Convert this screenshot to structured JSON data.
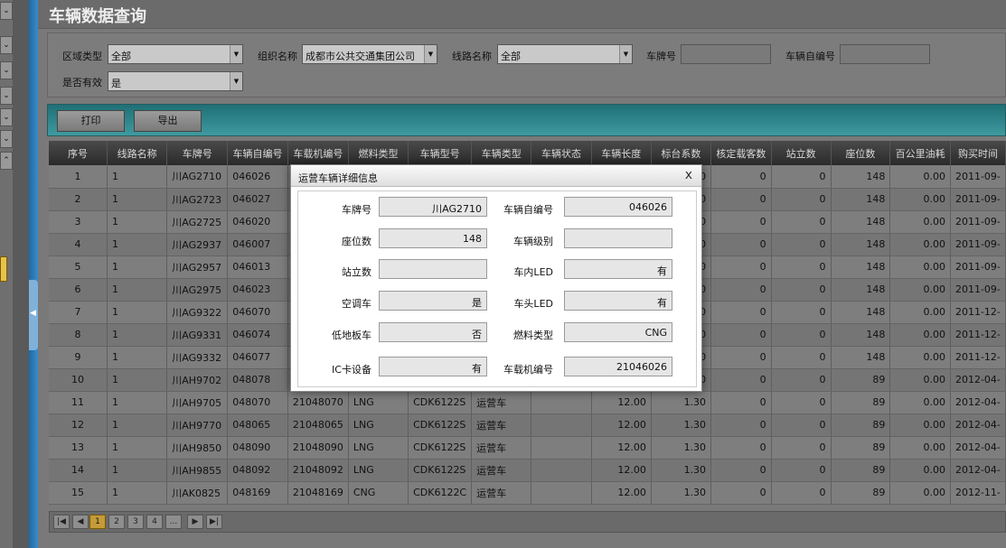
{
  "page_title": "车辆数据查询",
  "filters": {
    "area_type": {
      "label": "区域类型",
      "value": "全部"
    },
    "org_name": {
      "label": "组织名称",
      "value": "成都市公共交通集团公司"
    },
    "line_name": {
      "label": "线路名称",
      "value": "全部"
    },
    "plate_no": {
      "label": "车牌号",
      "value": ""
    },
    "self_no": {
      "label": "车辆自编号",
      "value": ""
    },
    "valid": {
      "label": "是否有效",
      "value": "是"
    }
  },
  "toolbar": {
    "print_label": "打印",
    "export_label": "导出"
  },
  "table": {
    "columns": [
      "序号",
      "线路名称",
      "车牌号",
      "车辆自编号",
      "车载机编号",
      "燃料类型",
      "车辆型号",
      "车辆类型",
      "车辆状态",
      "车辆长度",
      "标台系数",
      "核定载客数",
      "站立数",
      "座位数",
      "百公里油耗",
      "购买时间"
    ],
    "rows": [
      [
        "1",
        "1",
        "川AG2710",
        "046026",
        "",
        "",
        "",
        "",
        "",
        "",
        "0",
        "0",
        "0",
        "148",
        "0.00",
        "2011-09-"
      ],
      [
        "2",
        "1",
        "川AG2723",
        "046027",
        "",
        "",
        "",
        "",
        "",
        "",
        "0",
        "0",
        "0",
        "148",
        "0.00",
        "2011-09-"
      ],
      [
        "3",
        "1",
        "川AG2725",
        "046020",
        "",
        "",
        "",
        "",
        "",
        "",
        "0",
        "0",
        "0",
        "148",
        "0.00",
        "2011-09-"
      ],
      [
        "4",
        "1",
        "川AG2937",
        "046007",
        "",
        "",
        "",
        "",
        "",
        "",
        "0",
        "0",
        "0",
        "148",
        "0.00",
        "2011-09-"
      ],
      [
        "5",
        "1",
        "川AG2957",
        "046013",
        "",
        "",
        "",
        "",
        "",
        "",
        "0",
        "0",
        "0",
        "148",
        "0.00",
        "2011-09-"
      ],
      [
        "6",
        "1",
        "川AG2975",
        "046023",
        "",
        "",
        "",
        "",
        "",
        "",
        "0",
        "0",
        "0",
        "148",
        "0.00",
        "2011-09-"
      ],
      [
        "7",
        "1",
        "川AG9322",
        "046070",
        "",
        "",
        "",
        "",
        "",
        "",
        "0",
        "0",
        "0",
        "148",
        "0.00",
        "2011-12-"
      ],
      [
        "8",
        "1",
        "川AG9331",
        "046074",
        "",
        "",
        "",
        "",
        "",
        "",
        "0",
        "0",
        "0",
        "148",
        "0.00",
        "2011-12-"
      ],
      [
        "9",
        "1",
        "川AG9332",
        "046077",
        "",
        "",
        "",
        "",
        "",
        "",
        "0",
        "0",
        "0",
        "148",
        "0.00",
        "2011-12-"
      ],
      [
        "10",
        "1",
        "川AH9702",
        "048078",
        "",
        "",
        "",
        "",
        "",
        "",
        "0",
        "0",
        "0",
        "89",
        "0.00",
        "2012-04-"
      ],
      [
        "11",
        "1",
        "川AH9705",
        "048070",
        "21048070",
        "LNG",
        "CDK6122S",
        "运营车",
        "",
        "12.00",
        "1.30",
        "0",
        "0",
        "89",
        "0.00",
        "2012-04-"
      ],
      [
        "12",
        "1",
        "川AH9770",
        "048065",
        "21048065",
        "LNG",
        "CDK6122S",
        "运营车",
        "",
        "12.00",
        "1.30",
        "0",
        "0",
        "89",
        "0.00",
        "2012-04-"
      ],
      [
        "13",
        "1",
        "川AH9850",
        "048090",
        "21048090",
        "LNG",
        "CDK6122S",
        "运营车",
        "",
        "12.00",
        "1.30",
        "0",
        "0",
        "89",
        "0.00",
        "2012-04-"
      ],
      [
        "14",
        "1",
        "川AH9855",
        "048092",
        "21048092",
        "LNG",
        "CDK6122S",
        "运营车",
        "",
        "12.00",
        "1.30",
        "0",
        "0",
        "89",
        "0.00",
        "2012-04-"
      ],
      [
        "15",
        "1",
        "川AK0825",
        "048169",
        "21048169",
        "CNG",
        "CDK6122C",
        "运营车",
        "",
        "12.00",
        "1.30",
        "0",
        "0",
        "89",
        "0.00",
        "2012-11-"
      ]
    ]
  },
  "pager": {
    "first": "|◀",
    "prev": "◀",
    "pages": [
      "1",
      "2",
      "3",
      "4",
      "..."
    ],
    "next": "▶",
    "last": "▶|"
  },
  "dialog": {
    "title": "运营车辆详细信息",
    "close": "x",
    "fields": {
      "plate_no": {
        "label": "车牌号",
        "value": "川AG2710"
      },
      "self_no": {
        "label": "车辆自编号",
        "value": "046026"
      },
      "seats": {
        "label": "座位数",
        "value": "148"
      },
      "level": {
        "label": "车辆级别",
        "value": ""
      },
      "standing": {
        "label": "站立数",
        "value": ""
      },
      "inner_led": {
        "label": "车内LED",
        "value": "有"
      },
      "ac": {
        "label": "空调车",
        "value": "是"
      },
      "head_led": {
        "label": "车头LED",
        "value": "有"
      },
      "low_floor": {
        "label": "低地板车",
        "value": "否"
      },
      "fuel": {
        "label": "燃料类型",
        "value": "CNG"
      },
      "ic": {
        "label": "IC卡设备",
        "value": "有"
      },
      "device_no": {
        "label": "车载机编号",
        "value": "21046026"
      }
    }
  },
  "nav": {
    "arrows": [
      "⌄",
      "⌄",
      "⌄",
      "⌄",
      "⌄",
      "⌄",
      "⌃"
    ],
    "splitter_arrow": "◀"
  }
}
